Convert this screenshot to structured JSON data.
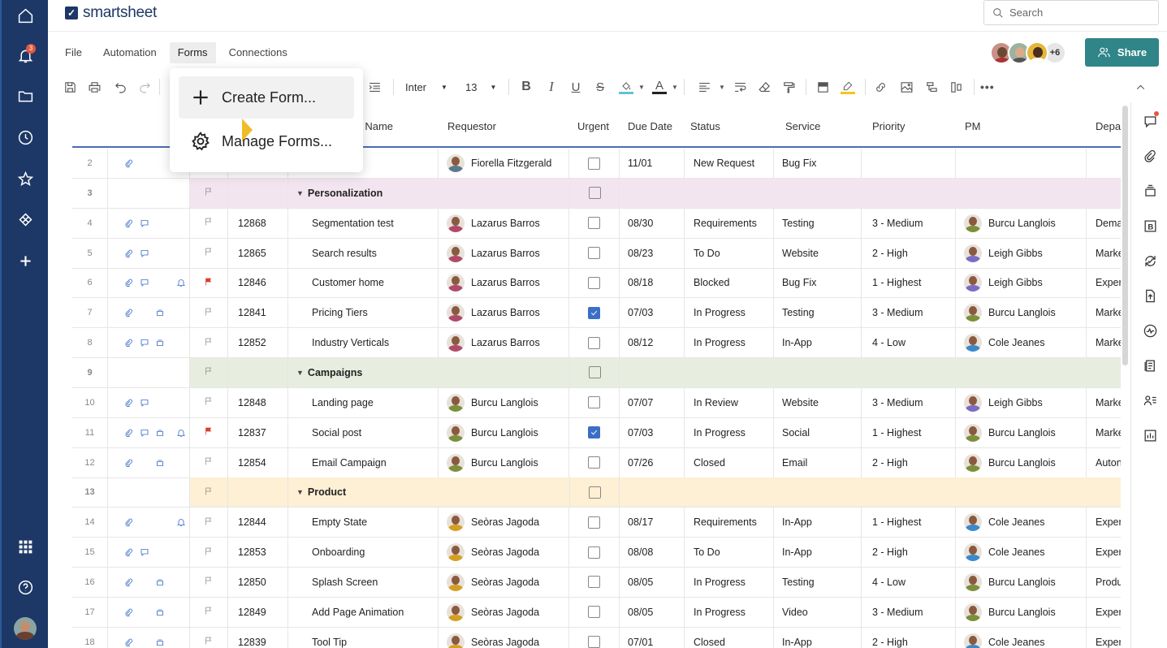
{
  "app": {
    "name": "smartsheet",
    "logo_mark": "✓"
  },
  "leftnav": {
    "items": [
      {
        "name": "home-icon"
      },
      {
        "name": "notifications-icon",
        "badge": "3"
      },
      {
        "name": "folder-icon"
      },
      {
        "name": "recents-clock-icon"
      },
      {
        "name": "favorites-star-icon"
      },
      {
        "name": "solution-center-icon"
      },
      {
        "name": "create-plus-icon"
      }
    ],
    "bottom": [
      {
        "name": "apps-grid-icon"
      },
      {
        "name": "help-icon"
      },
      {
        "name": "profile-avatar"
      }
    ]
  },
  "search": {
    "placeholder": "Search"
  },
  "menubar": {
    "items": [
      "File",
      "Automation",
      "Forms",
      "Connections"
    ],
    "active": "Forms"
  },
  "collaborators": {
    "more": "+6"
  },
  "share": {
    "label": "Share"
  },
  "toolbar": {
    "font": "Inter",
    "size": "13",
    "more": "•••"
  },
  "dropdown": {
    "items": [
      {
        "label": "Create Form...",
        "icon": "plus-icon"
      },
      {
        "label": "Manage Forms...",
        "icon": "gear-icon"
      }
    ]
  },
  "columns": [
    "Task Name",
    "Requestor",
    "Urgent",
    "Due Date",
    "Status",
    "Service",
    "Priority",
    "PM",
    "Depa"
  ],
  "rows": [
    {
      "n": "2",
      "icons": "a",
      "flag": "",
      "id": "",
      "task": "",
      "req": "Fiorella Fitzgerald",
      "reqc": "#5a7a8c",
      "urgent": false,
      "due": "11/01",
      "status": "New Request",
      "service": "Bug Fix",
      "priority": "",
      "pm": "",
      "pmc": "",
      "dept": ""
    },
    {
      "n": "3",
      "group": true,
      "bg": "#f3e5ef",
      "title": "Personalization",
      "flag": "p"
    },
    {
      "n": "4",
      "icons": "ac",
      "flag": "p",
      "id": "12868",
      "task": "Segmentation test",
      "req": "Lazarus Barros",
      "reqc": "#b04a6a",
      "urgent": false,
      "due": "08/30",
      "status": "Requirements",
      "service": "Testing",
      "priority": "3 - Medium",
      "pm": "Burcu Langlois",
      "pmc": "#7c8f3a",
      "dept": "Dema"
    },
    {
      "n": "5",
      "icons": "ac",
      "flag": "p",
      "id": "12865",
      "task": "Search results",
      "req": "Lazarus Barros",
      "reqc": "#b04a6a",
      "urgent": false,
      "due": "08/23",
      "status": "To Do",
      "service": "Website",
      "priority": "2 - High",
      "pm": "Leigh Gibbs",
      "pmc": "#7b6bc4",
      "dept": "Marke"
    },
    {
      "n": "6",
      "icons": "acb",
      "flag": "r",
      "id": "12846",
      "task": "Customer home",
      "req": "Lazarus Barros",
      "reqc": "#b04a6a",
      "urgent": false,
      "due": "08/18",
      "status": "Blocked",
      "service": "Bug Fix",
      "priority": "1 - Highest",
      "pm": "Leigh Gibbs",
      "pmc": "#7b6bc4",
      "dept": "Exper"
    },
    {
      "n": "7",
      "icons": "ax",
      "flag": "p",
      "id": "12841",
      "task": "Pricing Tiers",
      "req": "Lazarus Barros",
      "reqc": "#b04a6a",
      "urgent": true,
      "due": "07/03",
      "status": "In Progress",
      "service": "Testing",
      "priority": "3 - Medium",
      "pm": "Burcu Langlois",
      "pmc": "#7c8f3a",
      "dept": "Marke"
    },
    {
      "n": "8",
      "icons": "acx",
      "flag": "p",
      "id": "12852",
      "task": "Industry Verticals",
      "req": "Lazarus Barros",
      "reqc": "#b04a6a",
      "urgent": false,
      "due": "08/12",
      "status": "In Progress",
      "service": "In-App",
      "priority": "4 - Low",
      "pm": "Cole Jeanes",
      "pmc": "#3b89c9",
      "dept": "Marke"
    },
    {
      "n": "9",
      "group": true,
      "bg": "#e7eedf",
      "title": "Campaigns",
      "flag": "p"
    },
    {
      "n": "10",
      "icons": "ac",
      "flag": "p",
      "id": "12848",
      "task": "Landing page",
      "req": "Burcu Langlois",
      "reqc": "#7c8f3a",
      "urgent": false,
      "due": "07/07",
      "status": "In Review",
      "service": "Website",
      "priority": "3 - Medium",
      "pm": "Leigh Gibbs",
      "pmc": "#7b6bc4",
      "dept": "Marke"
    },
    {
      "n": "11",
      "icons": "acxb",
      "flag": "r",
      "id": "12837",
      "task": "Social post",
      "req": "Burcu Langlois",
      "reqc": "#7c8f3a",
      "urgent": true,
      "due": "07/03",
      "status": "In Progress",
      "service": "Social",
      "priority": "1 - Highest",
      "pm": "Burcu Langlois",
      "pmc": "#7c8f3a",
      "dept": "Marke"
    },
    {
      "n": "12",
      "icons": "ax",
      "flag": "p",
      "id": "12854",
      "task": "Email Campaign",
      "req": "Burcu Langlois",
      "reqc": "#7c8f3a",
      "urgent": false,
      "due": "07/26",
      "status": "Closed",
      "service": "Email",
      "priority": "2 - High",
      "pm": "Burcu Langlois",
      "pmc": "#7c8f3a",
      "dept": "Auton"
    },
    {
      "n": "13",
      "group": true,
      "bg": "#fdf0d5",
      "title": "Product",
      "flag": "p"
    },
    {
      "n": "14",
      "icons": "ab",
      "flag": "p",
      "id": "12844",
      "task": "Empty State",
      "req": "Seòras Jagoda",
      "reqc": "#d4a021",
      "urgent": false,
      "due": "08/17",
      "status": "Requirements",
      "service": "In-App",
      "priority": "1 - Highest",
      "pm": "Cole Jeanes",
      "pmc": "#3b89c9",
      "dept": "Exper"
    },
    {
      "n": "15",
      "icons": "ac",
      "flag": "p",
      "id": "12853",
      "task": "Onboarding",
      "req": "Seòras Jagoda",
      "reqc": "#d4a021",
      "urgent": false,
      "due": "08/08",
      "status": "To Do",
      "service": "In-App",
      "priority": "2 - High",
      "pm": "Cole Jeanes",
      "pmc": "#3b89c9",
      "dept": "Exper"
    },
    {
      "n": "16",
      "icons": "ax",
      "flag": "p",
      "id": "12850",
      "task": "Splash Screen",
      "req": "Seòras Jagoda",
      "reqc": "#d4a021",
      "urgent": false,
      "due": "08/05",
      "status": "In Progress",
      "service": "Testing",
      "priority": "4 - Low",
      "pm": "Burcu Langlois",
      "pmc": "#7c8f3a",
      "dept": "Produ"
    },
    {
      "n": "17",
      "icons": "ax",
      "flag": "p",
      "id": "12849",
      "task": "Add Page Animation",
      "req": "Seòras Jagoda",
      "reqc": "#d4a021",
      "urgent": false,
      "due": "08/05",
      "status": "In Progress",
      "service": "Video",
      "priority": "3 - Medium",
      "pm": "Burcu Langlois",
      "pmc": "#7c8f3a",
      "dept": "Exper"
    },
    {
      "n": "18",
      "icons": "ax",
      "flag": "p",
      "id": "12839",
      "task": "Tool Tip",
      "req": "Seòras Jagoda",
      "reqc": "#d4a021",
      "urgent": false,
      "due": "07/01",
      "status": "Closed",
      "service": "In-App",
      "priority": "2 - High",
      "pm": "Cole Jeanes",
      "pmc": "#3b89c9",
      "dept": "Exper"
    }
  ],
  "colors": {
    "nav": "#1d3866",
    "accent": "#2f8587",
    "link": "#3b6fc6",
    "flag_red": "#d7402c"
  }
}
